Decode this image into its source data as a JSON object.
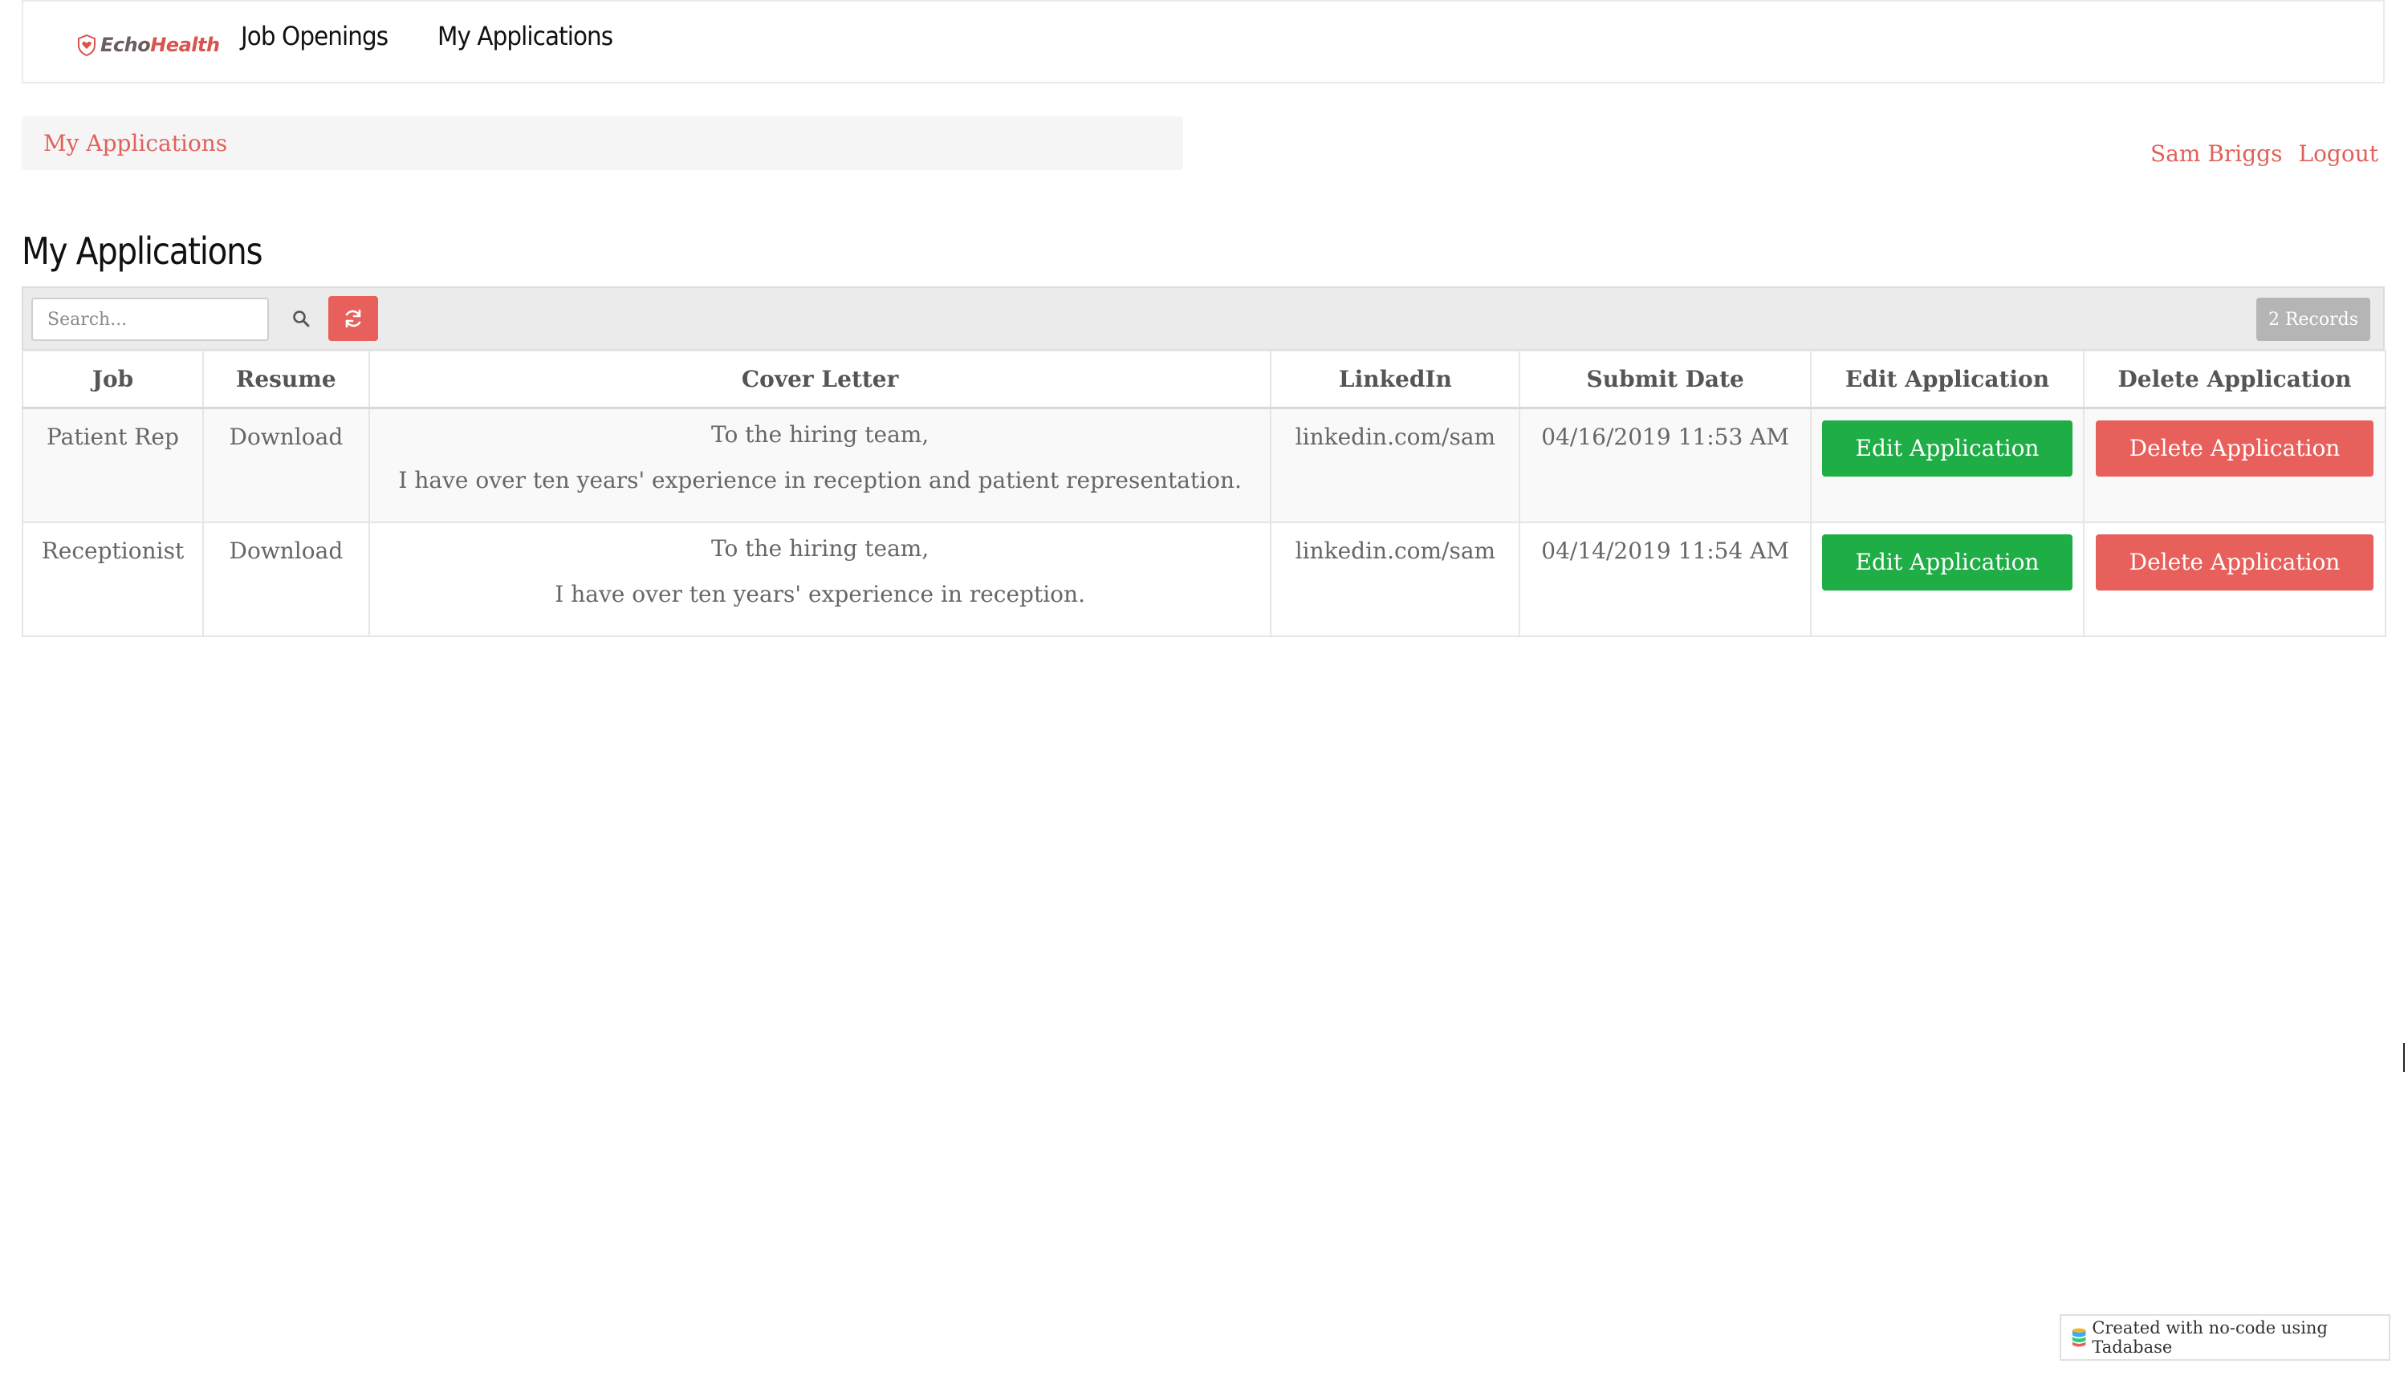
{
  "nav": {
    "logo_text_echo": "Echo",
    "logo_text_health": "Health",
    "items": [
      {
        "label": "Job Openings"
      },
      {
        "label": "My Applications"
      }
    ]
  },
  "breadcrumb": {
    "current": "My Applications"
  },
  "user": {
    "name": "Sam Briggs",
    "logout_label": "Logout"
  },
  "page": {
    "title": "My Applications"
  },
  "toolbar": {
    "search_placeholder": "Search...",
    "search_value": "",
    "records_label": "2 Records"
  },
  "table": {
    "columns": [
      "Job",
      "Resume",
      "Cover Letter",
      "LinkedIn",
      "Submit Date",
      "Edit Application",
      "Delete Application"
    ],
    "rows": [
      {
        "job": "Patient Rep",
        "resume": "Download",
        "cover_line1": "To the hiring team,",
        "cover_line2": "I have over ten years' experience in reception and patient representation.",
        "linkedin": "linkedin.com/sam",
        "submit_date": "04/16/2019 11:53 AM",
        "edit_label": "Edit Application",
        "delete_label": "Delete Application"
      },
      {
        "job": "Receptionist",
        "resume": "Download",
        "cover_line1": "To the hiring team,",
        "cover_line2": "I have over ten years' experience in reception.",
        "linkedin": "linkedin.com/sam",
        "submit_date": "04/14/2019 11:54 AM",
        "edit_label": "Edit Application",
        "delete_label": "Delete Application"
      }
    ]
  },
  "footer": {
    "badge_text": "Created with no-code using Tadabase"
  },
  "colors": {
    "accent": "#e8605b",
    "edit_green": "#1fad45",
    "link_red": "#e0605a"
  },
  "icons": {
    "logo": "heart-shield-icon",
    "search": "search-icon",
    "refresh": "refresh-icon",
    "tadabase": "database-icon"
  }
}
